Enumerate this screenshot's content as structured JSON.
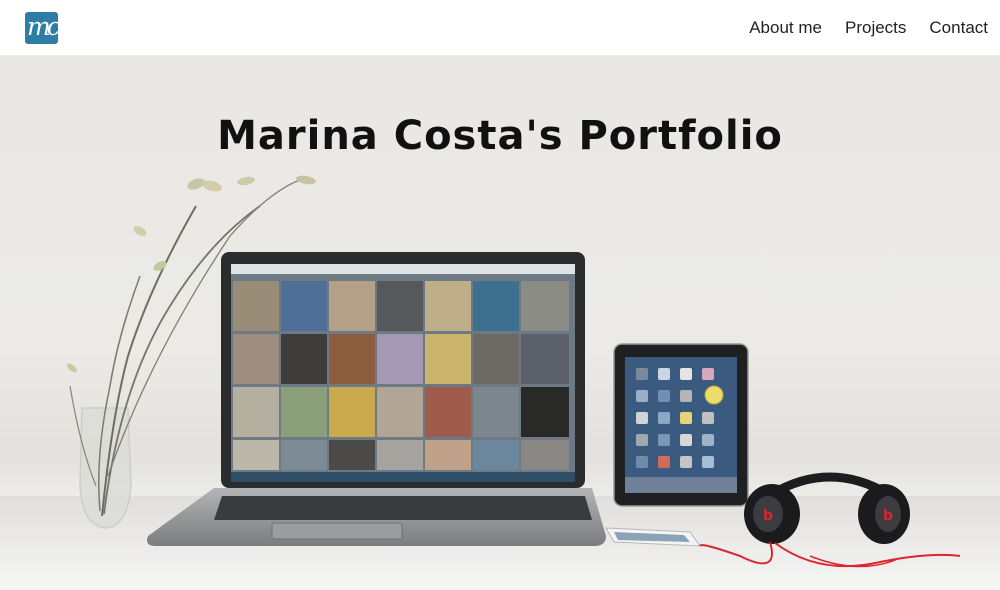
{
  "navbar": {
    "logo_text": "mc",
    "links": [
      {
        "label": "About me"
      },
      {
        "label": "Projects"
      },
      {
        "label": "Contact"
      }
    ]
  },
  "hero": {
    "title": "Marina Costa's Portfolio"
  },
  "colors": {
    "brand": "#2e7da6",
    "nav_text": "#222222",
    "hero_bg": "#e9e8e4",
    "headphone_cable": "#d8282e"
  },
  "icons": [
    "logo-icon",
    "laptop-image",
    "tablet-image",
    "headphones-image",
    "phone-image",
    "vase-image"
  ]
}
